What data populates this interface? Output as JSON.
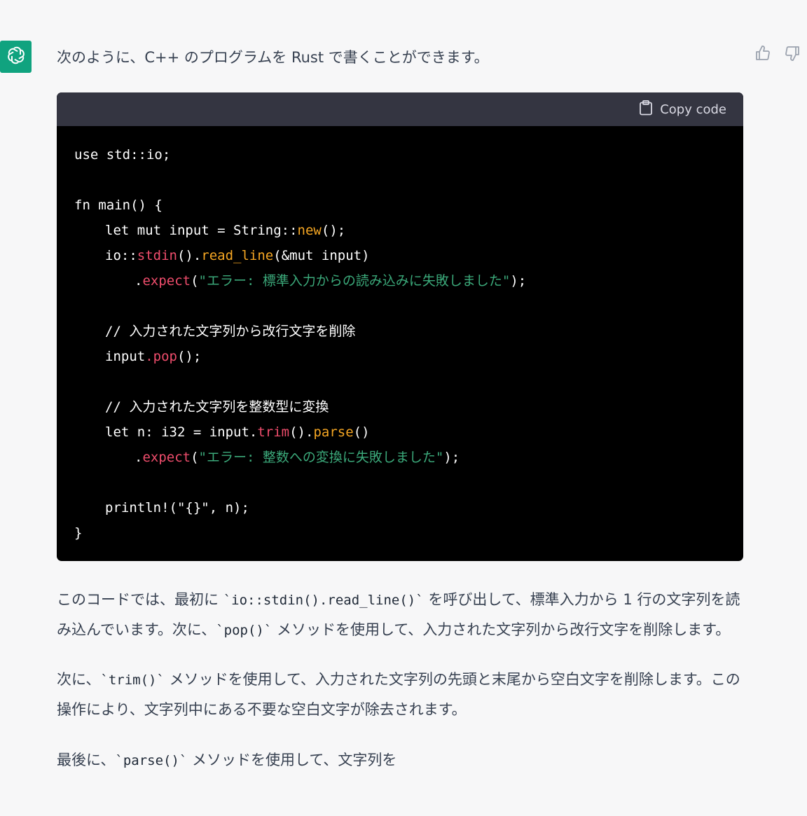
{
  "assistant": {
    "avatar_icon": "openai-logo-icon",
    "avatar_color": "#10a37f"
  },
  "feedback": {
    "thumbs_up_icon": "thumbs-up-icon",
    "thumbs_down_icon": "thumbs-down-icon"
  },
  "message": {
    "intro": "次のように、C++ のプログラムを Rust で書くことができます。",
    "code_block": {
      "copy_label": "Copy code",
      "copy_icon": "clipboard-icon",
      "background": "#000000",
      "header_background": "#343541",
      "lines": {
        "l1": "use std::io;",
        "l3": "fn main() {",
        "l4_a": "let mut input = String::",
        "l4_b": "new",
        "l4_c": "();",
        "l5_a": "io::",
        "l5_b": "stdin",
        "l5_c": "().",
        "l5_d": "read_line",
        "l5_e": "(&mut input)",
        "l6_a": ".",
        "l6_b": "expect",
        "l6_c": "(",
        "l6_d": "\"エラー: 標準入力からの読み込みに失敗しました\"",
        "l6_e": ");",
        "l8": "// 入力された文字列から改行文字を削除",
        "l9_a": "input",
        "l9_b": ".pop",
        "l9_c": "();",
        "l11": "// 入力された文字列を整数型に変換",
        "l12_a": "let n: i32 = input.",
        "l12_b": "trim",
        "l12_c": "().",
        "l12_d": "parse",
        "l12_e": "()",
        "l13_a": ".",
        "l13_b": "expect",
        "l13_c": "(",
        "l13_d": "\"エラー: 整数への変換に失敗しました\"",
        "l13_e": ");",
        "l15": "println!(\"{}\", n);",
        "l16": "}"
      }
    },
    "p1": {
      "a": "このコードでは、最初に ",
      "code1": "`io::stdin().read_line()`",
      "b": " を呼び出して、標準入力から 1 行の文字列を読",
      "line2_a": "み込んでいます。次に、",
      "code2": "`pop()`",
      "line2_b": " メソッドを使用して、入力された文字列から改行文字を削除します。"
    },
    "p2": {
      "a": "次に、",
      "code": "`trim()`",
      "b": " メソッドを使用して、入力された文字列の先頭と末尾から空白文字を削除します。この",
      "line2": "操作により、文字列中にある不要な空白文字が除去されます。"
    },
    "p3": {
      "a": "最後に、",
      "code": "`parse()`",
      "b": " メソッドを使用して、文字列を"
    }
  }
}
